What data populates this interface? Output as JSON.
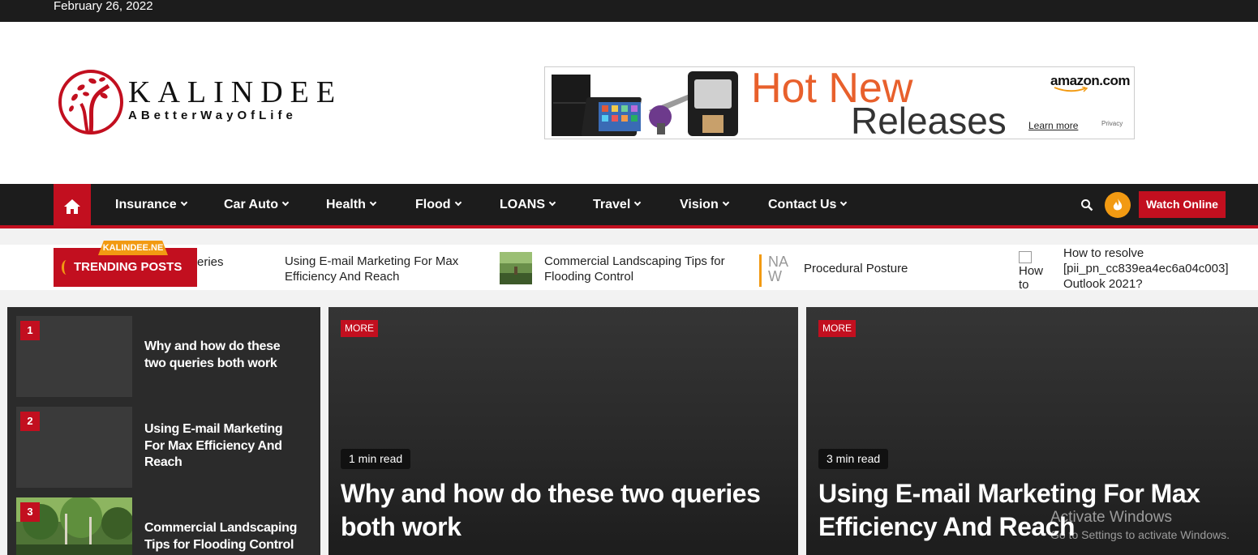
{
  "topbar": {
    "date": "February 26, 2022"
  },
  "logo": {
    "name": "KALINDEE",
    "tagline": "ABetterWayOfLife"
  },
  "ad": {
    "line1": "Hot New",
    "line2": "Releases",
    "brand": "amazon.com",
    "learn_more": "Learn more",
    "privacy": "Privacy"
  },
  "nav": {
    "items": [
      {
        "label": "Insurance"
      },
      {
        "label": "Car Auto"
      },
      {
        "label": "Health"
      },
      {
        "label": "Flood"
      },
      {
        "label": "LOANS"
      },
      {
        "label": "Travel"
      },
      {
        "label": "Vision"
      },
      {
        "label": "Contact Us"
      }
    ],
    "watch_label": "Watch Online"
  },
  "ticker": {
    "label": "TRENDING POSTS",
    "flag": "KALINDEE.NE",
    "items": [
      {
        "title": "eries"
      },
      {
        "title": "Using E-mail Marketing For Max Efficiency And Reach"
      },
      {
        "title": "Commercial Landscaping Tips for Flooding Control"
      },
      {
        "thumb_text": "NA W"
      },
      {
        "title": "Procedural Posture"
      },
      {
        "thumb_text": "How to"
      },
      {
        "title": "How to resolve [pii_pn_cc839ea4ec6a04c003] Outlook 2021?"
      }
    ]
  },
  "popular": [
    {
      "num": "1",
      "title": "Why and how do these two queries both work"
    },
    {
      "num": "2",
      "title": "Using E-mail Marketing For Max Efficiency And Reach"
    },
    {
      "num": "3",
      "title": "Commercial Landscaping Tips for Flooding Control"
    }
  ],
  "cards": [
    {
      "category": "MORE",
      "read_time": "1 min read",
      "title": "Why and how do these two queries both work"
    },
    {
      "category": "MORE",
      "read_time": "3 min read",
      "title": "Using E-mail Marketing For Max Efficiency And Reach"
    }
  ],
  "watermark": {
    "line1": "Activate Windows",
    "line2": "Go to Settings to activate Windows."
  },
  "colors": {
    "accent": "#c20f1f",
    "dark": "#1c1c1c",
    "orange": "#f29a12"
  }
}
